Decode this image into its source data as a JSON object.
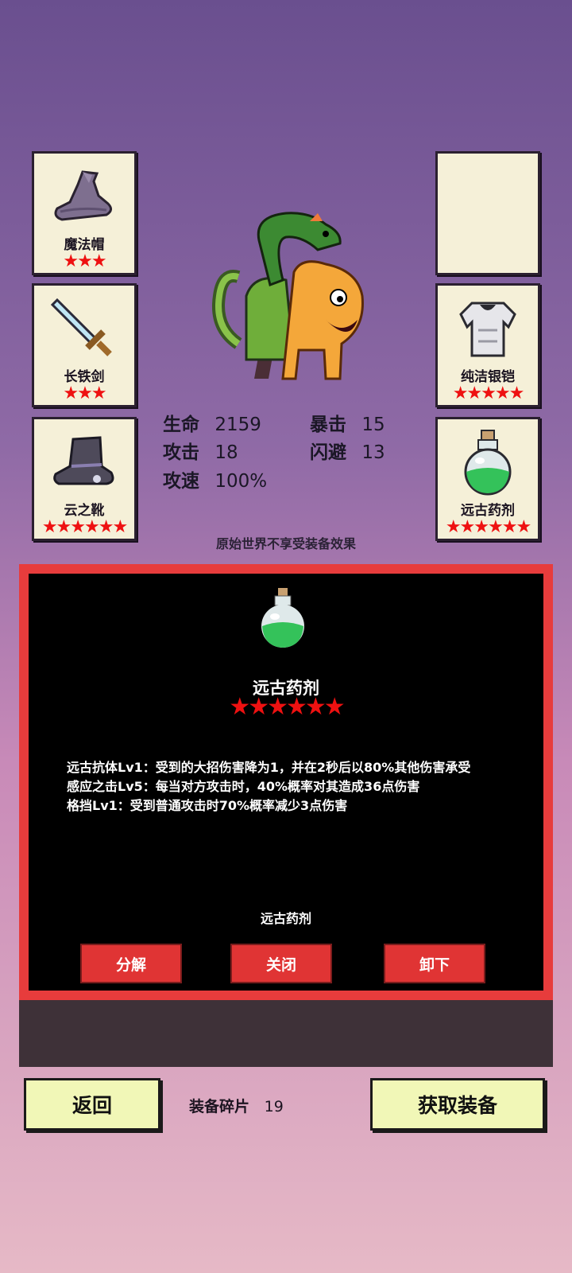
{
  "slots": {
    "left": [
      {
        "name": "魔法帽",
        "stars": "★★★",
        "icon": "wizard-hat-icon"
      },
      {
        "name": "长铁剑",
        "stars": "★★★",
        "icon": "sword-icon"
      },
      {
        "name": "云之靴",
        "stars": "★★★★★★",
        "icon": "boot-icon"
      }
    ],
    "right": [
      {
        "name": "",
        "stars": "",
        "icon": ""
      },
      {
        "name": "纯洁银铠",
        "stars": "★★★★★",
        "icon": "armor-icon"
      },
      {
        "name": "远古药剂",
        "stars": "★★★★★★",
        "icon": "green-potion-icon"
      }
    ]
  },
  "stats": {
    "hp_label": "生命",
    "hp_value": "2159",
    "crit_label": "暴击",
    "crit_value": "15",
    "atk_label": "攻击",
    "atk_value": "18",
    "dodge_label": "闪避",
    "dodge_value": "13",
    "speed_label": "攻速",
    "speed_value": "100%"
  },
  "notice": "原始世界不享受装备效果",
  "detail": {
    "title": "远古药剂",
    "stars": "★★★★★★",
    "lines": [
      "远古抗体Lv1：受到的大招伤害降为1，并在2秒后以80%其他伤害承受",
      "感应之击Lv5：每当对方攻击时，40%概率对其造成36点伤害",
      "格挡Lv1：受到普通攻击时70%概率减少3点伤害"
    ],
    "footer_name": "远古药剂",
    "buttons": {
      "decompose": "分解",
      "close": "关闭",
      "unequip": "卸下"
    }
  },
  "bottom": {
    "back": "返回",
    "fragments_label": "装备碎片",
    "fragments_value": "19",
    "get_equipment": "获取装备"
  },
  "colors": {
    "star": "#e11",
    "panel_border": "#e73c3c",
    "button_red": "#e03434",
    "bottom_button": "#f1f7b7"
  }
}
